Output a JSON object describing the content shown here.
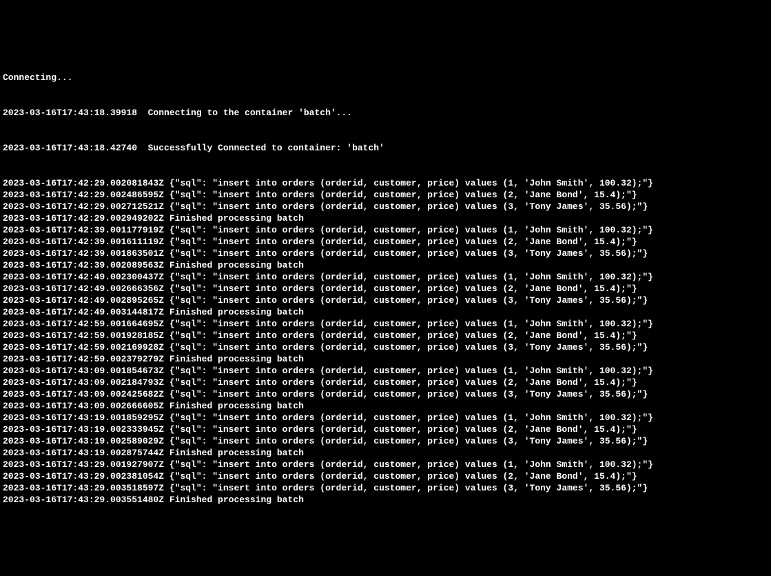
{
  "header": {
    "connecting": "Connecting...",
    "line1": "2023-03-16T17:43:18.39918  Connecting to the container 'batch'...",
    "line2": "2023-03-16T17:43:18.42740  Successfully Connected to container: 'batch'"
  },
  "batches": [
    {
      "ts_base": "2023-03-16T17:42:29",
      "lines": [
        {
          "ts": "2023-03-16T17:42:29.002081843Z",
          "sql": "insert into orders (orderid, customer, price) values (1, 'John Smith', 100.32);"
        },
        {
          "ts": "2023-03-16T17:42:29.002486595Z",
          "sql": "insert into orders (orderid, customer, price) values (2, 'Jane Bond', 15.4);"
        },
        {
          "ts": "2023-03-16T17:42:29.002712521Z",
          "sql": "insert into orders (orderid, customer, price) values (3, 'Tony James', 35.56);"
        }
      ],
      "finish_ts": "2023-03-16T17:42:29.002949202Z",
      "finish_msg": "Finished processing batch"
    },
    {
      "ts_base": "2023-03-16T17:42:39",
      "lines": [
        {
          "ts": "2023-03-16T17:42:39.001177919Z",
          "sql": "insert into orders (orderid, customer, price) values (1, 'John Smith', 100.32);"
        },
        {
          "ts": "2023-03-16T17:42:39.001611119Z",
          "sql": "insert into orders (orderid, customer, price) values (2, 'Jane Bond', 15.4);"
        },
        {
          "ts": "2023-03-16T17:42:39.001863501Z",
          "sql": "insert into orders (orderid, customer, price) values (3, 'Tony James', 35.56);"
        }
      ],
      "finish_ts": "2023-03-16T17:42:39.002089563Z",
      "finish_msg": "Finished processing batch"
    },
    {
      "ts_base": "2023-03-16T17:42:49",
      "lines": [
        {
          "ts": "2023-03-16T17:42:49.002300437Z",
          "sql": "insert into orders (orderid, customer, price) values (1, 'John Smith', 100.32);"
        },
        {
          "ts": "2023-03-16T17:42:49.002666356Z",
          "sql": "insert into orders (orderid, customer, price) values (2, 'Jane Bond', 15.4);"
        },
        {
          "ts": "2023-03-16T17:42:49.002895265Z",
          "sql": "insert into orders (orderid, customer, price) values (3, 'Tony James', 35.56);"
        }
      ],
      "finish_ts": "2023-03-16T17:42:49.003144817Z",
      "finish_msg": "Finished processing batch"
    },
    {
      "ts_base": "2023-03-16T17:42:59",
      "lines": [
        {
          "ts": "2023-03-16T17:42:59.001664695Z",
          "sql": "insert into orders (orderid, customer, price) values (1, 'John Smith', 100.32);"
        },
        {
          "ts": "2023-03-16T17:42:59.001928185Z",
          "sql": "insert into orders (orderid, customer, price) values (2, 'Jane Bond', 15.4);"
        },
        {
          "ts": "2023-03-16T17:42:59.002169928Z",
          "sql": "insert into orders (orderid, customer, price) values (3, 'Tony James', 35.56);"
        }
      ],
      "finish_ts": "2023-03-16T17:42:59.002379279Z",
      "finish_msg": "Finished processing batch"
    },
    {
      "ts_base": "2023-03-16T17:43:09",
      "lines": [
        {
          "ts": "2023-03-16T17:43:09.001854673Z",
          "sql": "insert into orders (orderid, customer, price) values (1, 'John Smith', 100.32);"
        },
        {
          "ts": "2023-03-16T17:43:09.002184793Z",
          "sql": "insert into orders (orderid, customer, price) values (2, 'Jane Bond', 15.4);"
        },
        {
          "ts": "2023-03-16T17:43:09.002425682Z",
          "sql": "insert into orders (orderid, customer, price) values (3, 'Tony James', 35.56);"
        }
      ],
      "finish_ts": "2023-03-16T17:43:09.002666605Z",
      "finish_msg": "Finished processing batch"
    },
    {
      "ts_base": "2023-03-16T17:43:19",
      "lines": [
        {
          "ts": "2023-03-16T17:43:19.001859295Z",
          "sql": "insert into orders (orderid, customer, price) values (1, 'John Smith', 100.32);"
        },
        {
          "ts": "2023-03-16T17:43:19.002333945Z",
          "sql": "insert into orders (orderid, customer, price) values (2, 'Jane Bond', 15.4);"
        },
        {
          "ts": "2023-03-16T17:43:19.002589029Z",
          "sql": "insert into orders (orderid, customer, price) values (3, 'Tony James', 35.56);"
        }
      ],
      "finish_ts": "2023-03-16T17:43:19.002875744Z",
      "finish_msg": "Finished processing batch"
    },
    {
      "ts_base": "2023-03-16T17:43:29",
      "lines": [
        {
          "ts": "2023-03-16T17:43:29.001927907Z",
          "sql": "insert into orders (orderid, customer, price) values (1, 'John Smith', 100.32);"
        },
        {
          "ts": "2023-03-16T17:43:29.002381054Z",
          "sql": "insert into orders (orderid, customer, price) values (2, 'Jane Bond', 15.4);"
        },
        {
          "ts": "2023-03-16T17:43:29.003518597Z",
          "sql": "insert into orders (orderid, customer, price) values (3, 'Tony James', 35.56);"
        }
      ],
      "finish_ts": "2023-03-16T17:43:29.003551480Z",
      "finish_msg": "Finished processing batch"
    }
  ]
}
